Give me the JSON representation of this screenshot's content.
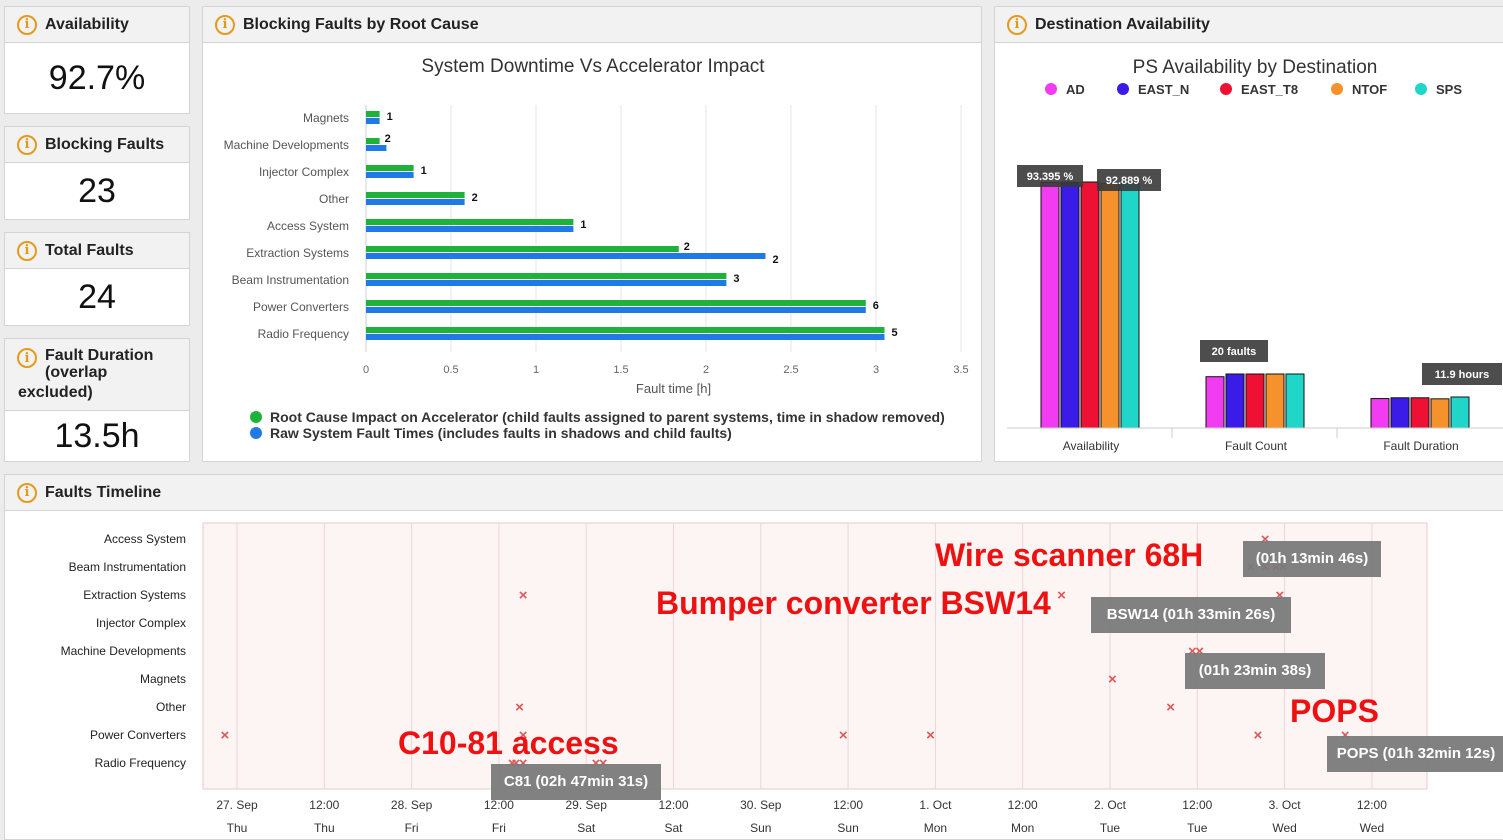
{
  "kpis": {
    "availability": {
      "title": "Availability",
      "value": "92.7%"
    },
    "blocking": {
      "title": "Blocking Faults",
      "value": "23"
    },
    "total": {
      "title": "Total Faults",
      "value": "24"
    },
    "duration": {
      "title_lines": [
        "Fault Duration",
        "(overlap",
        "excluded)"
      ],
      "value": "13.5h"
    }
  },
  "root_cause_panel": {
    "title": "Blocking Faults by Root Cause"
  },
  "destination_panel": {
    "title": "Destination Availability"
  },
  "timeline_panel": {
    "title": "Faults Timeline"
  },
  "colors": {
    "green": "#1fb23a",
    "blue": "#1f7ae8",
    "icon": "#e59a1e",
    "cross": "#e05555",
    "annotation": "#ee1111",
    "tooltip_bg": "#7a7a7a"
  },
  "chart_data": [
    {
      "type": "bar",
      "orientation": "horizontal",
      "title": "System Downtime Vs Accelerator Impact",
      "xlabel": "Fault time [h]",
      "xlim": [
        0,
        3.5
      ],
      "xticks": [
        "0",
        "0.5",
        "1",
        "1.5",
        "2",
        "2.5",
        "3",
        "3.5"
      ],
      "categories": [
        "Magnets",
        "Machine Developments",
        "Injector Complex",
        "Other",
        "Access System",
        "Extraction Systems",
        "Beam Instrumentation",
        "Power Converters",
        "Radio Frequency"
      ],
      "series": [
        {
          "name": "Root Cause Impact on Accelerator (child faults assigned to parent systems, time in shadow removed)",
          "color": "#1fb23a",
          "values": [
            0.08,
            0.08,
            0.28,
            0.58,
            1.22,
            1.84,
            2.12,
            2.94,
            3.05
          ]
        },
        {
          "name": "Raw System Fault Times (includes faults in shadows and child faults)",
          "color": "#1f7ae8",
          "values": [
            0.08,
            0.12,
            0.28,
            0.58,
            1.22,
            2.35,
            2.12,
            2.94,
            3.05
          ]
        }
      ],
      "labels": [
        "1",
        "2",
        "1",
        "2",
        "1",
        "2",
        "3",
        "6",
        "5"
      ],
      "extra_labels": [
        {
          "category": "Extraction Systems",
          "label": "2"
        }
      ],
      "legend": "bottom"
    },
    {
      "type": "bar",
      "title": "PS Availability by Destination",
      "categories": [
        "Availability",
        "Fault Count",
        "Fault Duration"
      ],
      "series": [
        {
          "name": "AD",
          "color": "#f23cf2",
          "values": [
            93.2,
            19,
            11.3
          ]
        },
        {
          "name": "EAST_N",
          "color": "#3a1be8",
          "values": [
            93.3,
            20,
            11.6
          ]
        },
        {
          "name": "EAST_T8",
          "color": "#ee1133",
          "values": [
            93.395,
            20,
            11.6
          ]
        },
        {
          "name": "NTOF",
          "color": "#f5922c",
          "values": [
            92.889,
            20,
            11.2
          ]
        },
        {
          "name": "SPS",
          "color": "#20d6c8",
          "values": [
            92.9,
            20,
            11.9
          ]
        }
      ],
      "tooltips": [
        "93.395 %",
        "92.889 %",
        "20 faults",
        "11.9 hours"
      ],
      "legend": "top"
    },
    {
      "type": "scatter",
      "title": "",
      "categories": [
        "Access System",
        "Beam Instrumentation",
        "Extraction Systems",
        "Injector Complex",
        "Machine Developments",
        "Magnets",
        "Other",
        "Power Converters",
        "Radio Frequency"
      ],
      "x_ticks": [
        {
          "date": "27. Sep",
          "day": "Thu"
        },
        {
          "date": "12:00",
          "day": "Thu"
        },
        {
          "date": "28. Sep",
          "day": "Fri"
        },
        {
          "date": "12:00",
          "day": "Fri"
        },
        {
          "date": "29. Sep",
          "day": "Sat"
        },
        {
          "date": "12:00",
          "day": "Sat"
        },
        {
          "date": "30. Sep",
          "day": "Sun"
        },
        {
          "date": "12:00",
          "day": "Sun"
        },
        {
          "date": "1. Oct",
          "day": "Mon"
        },
        {
          "date": "12:00",
          "day": "Mon"
        },
        {
          "date": "2. Oct",
          "day": "Tue"
        },
        {
          "date": "12:00",
          "day": "Tue"
        },
        {
          "date": "3. Oct",
          "day": "Wed"
        },
        {
          "date": "12:00",
          "day": "Wed"
        }
      ],
      "points": [
        {
          "category": "Access System",
          "x": "2018-10-02 22:00"
        },
        {
          "category": "Beam Instrumentation",
          "x": "2018-10-02 20:00"
        },
        {
          "category": "Beam Instrumentation",
          "x": "2018-10-02 22:00"
        },
        {
          "category": "Beam Instrumentation",
          "x": "2018-10-02 23:30"
        },
        {
          "category": "Beam Instrumentation",
          "x": "2018-10-03 00:30"
        },
        {
          "category": "Extraction Systems",
          "x": "2018-09-28 16:00"
        },
        {
          "category": "Extraction Systems",
          "x": "2018-10-01 18:00"
        },
        {
          "category": "Extraction Systems",
          "x": "2018-10-03 00:00"
        },
        {
          "category": "Machine Developments",
          "x": "2018-10-02 12:00"
        },
        {
          "category": "Machine Developments",
          "x": "2018-10-02 13:00"
        },
        {
          "category": "Magnets",
          "x": "2018-10-02 01:00"
        },
        {
          "category": "Other",
          "x": "2018-09-28 15:30"
        },
        {
          "category": "Other",
          "x": "2018-10-02 09:00"
        },
        {
          "category": "Power Converters",
          "x": "2018-09-26 23:00"
        },
        {
          "category": "Power Converters",
          "x": "2018-09-28 16:00"
        },
        {
          "category": "Power Converters",
          "x": "2018-09-30 12:00"
        },
        {
          "category": "Power Converters",
          "x": "2018-10-01 00:00"
        },
        {
          "category": "Power Converters",
          "x": "2018-10-02 21:00"
        },
        {
          "category": "Power Converters",
          "x": "2018-10-03 09:00"
        },
        {
          "category": "Radio Frequency",
          "x": "2018-09-28 14:30"
        },
        {
          "category": "Radio Frequency",
          "x": "2018-09-28 15:00"
        },
        {
          "category": "Radio Frequency",
          "x": "2018-09-28 16:00"
        },
        {
          "category": "Radio Frequency",
          "x": "2018-09-29 02:00"
        },
        {
          "category": "Radio Frequency",
          "x": "2018-09-29 03:00"
        }
      ],
      "tooltips": [
        "(01h 13min 46s)",
        "BSW14 (01h 33min 26s)",
        "(01h 23min 38s)",
        "POPS (01h 32min 12s)",
        "C81 (02h 47min 31s)"
      ],
      "annotations": [
        "Wire scanner 68H",
        "Bumper converter BSW14",
        "POPS",
        "C10-81 access"
      ]
    }
  ]
}
